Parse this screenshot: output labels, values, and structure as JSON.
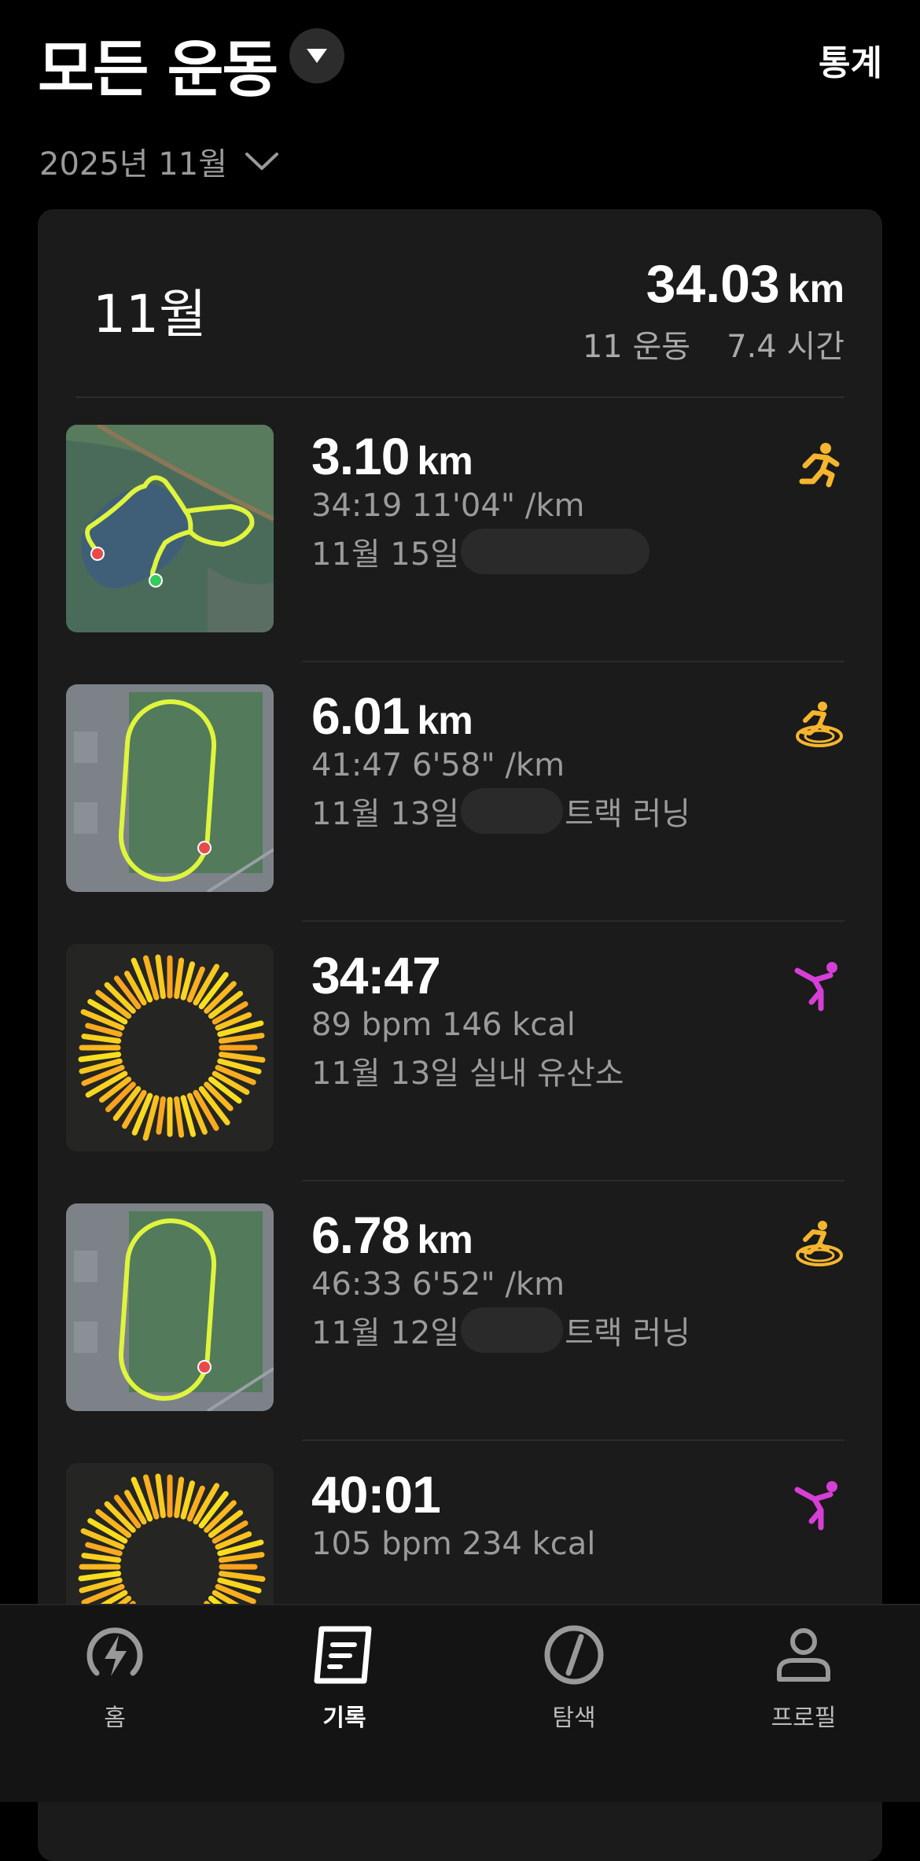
{
  "header": {
    "title": "모든 운동",
    "stats_label": "통계"
  },
  "month_picker": {
    "label": "2025년 11월"
  },
  "summary": {
    "month": "11월",
    "distance_value": "34.03",
    "distance_unit": "km",
    "workouts": "11 운동",
    "duration": "7.4 시간"
  },
  "activities": [
    {
      "value": "3.10",
      "unit": "km",
      "line1": "34:19  11'04\" /km",
      "date": "11월 15일",
      "suffix": "",
      "type_icon": "running-icon",
      "thumb": "map-lake"
    },
    {
      "value": "6.01",
      "unit": "km",
      "line1": "41:47  6'58\" /km",
      "date": "11월 13일",
      "suffix": "트랙 러닝",
      "type_icon": "track-running-icon",
      "thumb": "map-track"
    },
    {
      "value": "34:47",
      "unit": "",
      "line1": "89 bpm  146 kcal",
      "date": "11월 13일 실내 유산소",
      "suffix": "",
      "type_icon": "yoga-icon",
      "thumb": "sunburst"
    },
    {
      "value": "6.78",
      "unit": "km",
      "line1": "46:33  6'52\" /km",
      "date": "11월 12일",
      "suffix": "트랙 러닝",
      "type_icon": "track-running-icon",
      "thumb": "map-track"
    },
    {
      "value": "40:01",
      "unit": "",
      "line1": "105 bpm  234 kcal",
      "date": "",
      "suffix": "",
      "type_icon": "yoga-icon",
      "thumb": "sunburst"
    }
  ],
  "tabs": [
    {
      "label": "홈",
      "icon": "home-bolt-icon",
      "active": false
    },
    {
      "label": "기록",
      "icon": "record-icon",
      "active": true
    },
    {
      "label": "탐색",
      "icon": "compass-icon",
      "active": false
    },
    {
      "label": "프로필",
      "icon": "profile-icon",
      "active": false
    }
  ],
  "colors": {
    "accent": "#f5b52e",
    "route": "#e4f542",
    "yoga": "#d53fd6",
    "card": "#1a1b1a"
  }
}
